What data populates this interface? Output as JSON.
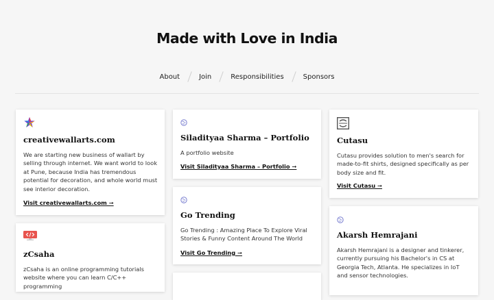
{
  "site": {
    "title": "Made with Love in India"
  },
  "nav": [
    {
      "label": "About"
    },
    {
      "label": "Join"
    },
    {
      "label": "Responsibilities"
    },
    {
      "label": "Sponsors"
    }
  ],
  "cards": [
    {
      "title": "creativewallarts.com",
      "icon": "colorful-star-icon",
      "description": "We are starting new business of wallart by selling through internet. We want world to look at Pune, because India has tremendous potential for decoration, and whole world must see interior decoration.",
      "link": "Visit creativewallarts.com ➞"
    },
    {
      "title": "zCsaha",
      "icon": "code-icon",
      "description": "zCsaha is an online programming tutorials website where you can learn C/C++ programming",
      "link": ""
    },
    {
      "title": "Siladityaa Sharma – Portfolio",
      "icon": "globe-icon",
      "description": "A portfolio website",
      "link": "Visit Siladityaa Sharma – Portfolio ➞"
    },
    {
      "title": "Go Trending",
      "icon": "globe-icon",
      "description": "Go Trending : Amazing Place To Explore Viral Stories & Funny Content Around The World",
      "link": "Visit Go Trending ➞"
    },
    {
      "title": "Cutasu",
      "icon": "cutasu-logo-icon",
      "description": "Cutasu provides solution to men's search for made-to-fit shirts, designed specifically as per body size and fit.",
      "link": "Visit Cutasu ➞"
    },
    {
      "title": "Akarsh Hemrajani",
      "icon": "globe-icon",
      "description": "Akarsh Hemrajani is a designer and tinkerer, currently pursuing his Bachelor's in CS at Georgia Tech, Atlanta. He specializes in IoT and sensor technologies.",
      "link": ""
    }
  ]
}
